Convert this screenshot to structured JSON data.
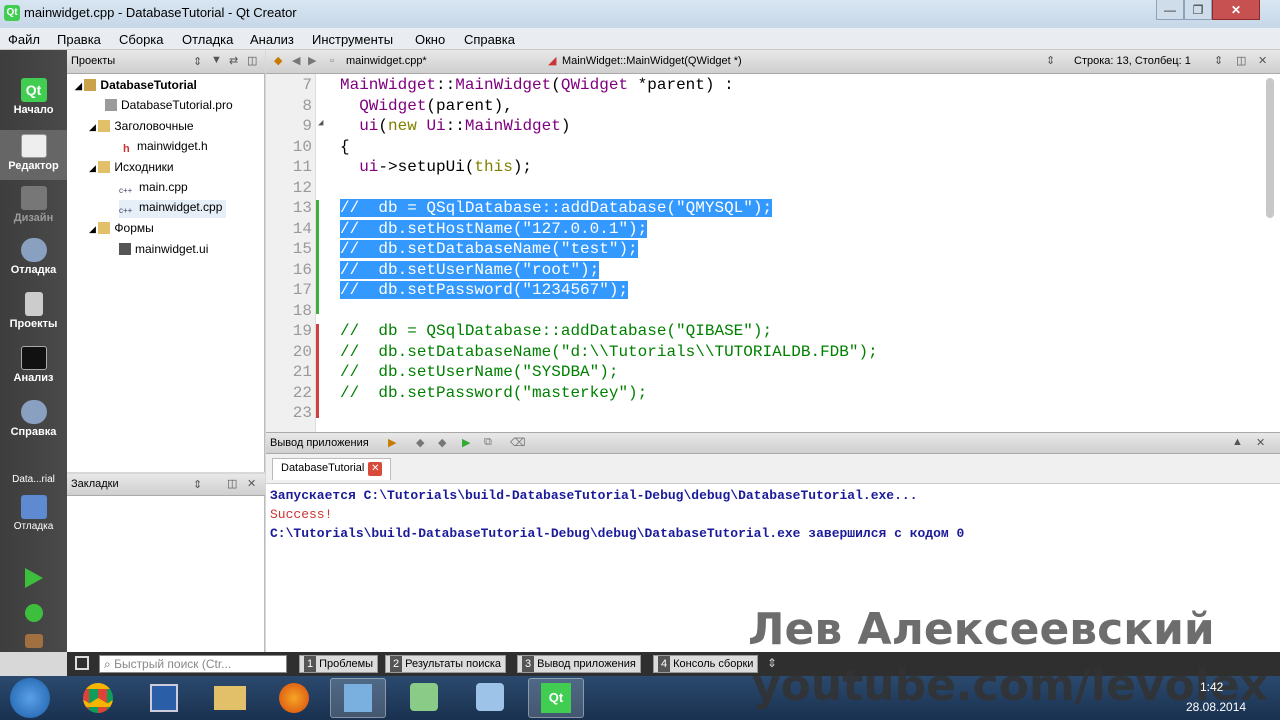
{
  "window": {
    "title": "mainwidget.cpp - DatabaseTutorial - Qt Creator",
    "app_icon_text": "Qt"
  },
  "menu": [
    "Файл",
    "Правка",
    "Сборка",
    "Отладка",
    "Анализ",
    "Инструменты",
    "Окно",
    "Справка"
  ],
  "modes": [
    {
      "label": "Начало",
      "icon": "qt-logo-icon"
    },
    {
      "label": "Редактор",
      "icon": "editor-icon"
    },
    {
      "label": "Дизайн",
      "icon": "design-icon"
    },
    {
      "label": "Отладка",
      "icon": "debug-icon"
    },
    {
      "label": "Проекты",
      "icon": "projects-icon"
    },
    {
      "label": "Анализ",
      "icon": "analyze-icon"
    },
    {
      "label": "Справка",
      "icon": "help-icon"
    }
  ],
  "target": {
    "name": "Data...rial",
    "label": "Отладка"
  },
  "projects_panel": {
    "header": "Проекты",
    "tree": [
      {
        "label": "DatabaseTutorial",
        "bold": true,
        "icon": "project-icon"
      },
      {
        "label": "DatabaseTutorial.pro",
        "icon": "pro-file-icon"
      },
      {
        "label": "Заголовочные",
        "icon": "folder-icon"
      },
      {
        "label": "mainwidget.h",
        "icon": "header-file-icon"
      },
      {
        "label": "Исходники",
        "icon": "folder-icon"
      },
      {
        "label": "main.cpp",
        "icon": "cpp-file-icon"
      },
      {
        "label": "mainwidget.cpp",
        "icon": "cpp-file-icon",
        "selected": true
      },
      {
        "label": "Формы",
        "icon": "folder-icon"
      },
      {
        "label": "mainwidget.ui",
        "icon": "ui-file-icon"
      }
    ]
  },
  "bookmarks_panel": {
    "header": "Закладки"
  },
  "editor": {
    "file_tab": "mainwidget.cpp*",
    "symbol": "MainWidget::MainWidget(QWidget *)",
    "cursor": "Строка: 13, Столбец: 1",
    "lines": [
      {
        "n": "7",
        "text": "MainWidget::MainWidget(QWidget *parent) :"
      },
      {
        "n": "8",
        "text": "  QWidget(parent),"
      },
      {
        "n": "9",
        "text": "  ui(new Ui::MainWidget)"
      },
      {
        "n": "10",
        "text": "{"
      },
      {
        "n": "11",
        "text": "  ui->setupUi(this);"
      },
      {
        "n": "12",
        "text": ""
      },
      {
        "n": "13",
        "text": "//  db = QSqlDatabase::addDatabase(\"QMYSQL\");",
        "selected": true
      },
      {
        "n": "14",
        "text": "//  db.setHostName(\"127.0.0.1\");",
        "selected": true
      },
      {
        "n": "15",
        "text": "//  db.setDatabaseName(\"test\");",
        "selected": true
      },
      {
        "n": "16",
        "text": "//  db.setUserName(\"root\");",
        "selected": true
      },
      {
        "n": "17",
        "text": "//  db.setPassword(\"1234567\");",
        "selected": true
      },
      {
        "n": "18",
        "text": ""
      },
      {
        "n": "19",
        "text": "//  db = QSqlDatabase::addDatabase(\"QIBASE\");",
        "comment": true
      },
      {
        "n": "20",
        "text": "//  db.setDatabaseName(\"d:\\\\Tutorials\\\\TUTORIALDB.FDB\");",
        "comment": true
      },
      {
        "n": "21",
        "text": "//  db.setUserName(\"SYSDBA\");",
        "comment": true
      },
      {
        "n": "22",
        "text": "//  db.setPassword(\"masterkey\");",
        "comment": true
      },
      {
        "n": "23",
        "text": ""
      }
    ]
  },
  "output": {
    "header": "Вывод приложения",
    "tab": "DatabaseTutorial",
    "lines": [
      {
        "text": "Запускается C:\\Tutorials\\build-DatabaseTutorial-Debug\\debug\\DatabaseTutorial.exe...",
        "color": "#1a1a9a"
      },
      {
        "text": "Success!",
        "color": "#cc3333"
      },
      {
        "text": "C:\\Tutorials\\build-DatabaseTutorial-Debug\\debug\\DatabaseTutorial.exe завершился с кодом 0",
        "color": "#1a1a9a"
      }
    ]
  },
  "statusbar": {
    "search_placeholder": "Быстрый поиск (Ctr...",
    "buttons": [
      {
        "num": "1",
        "label": "Проблемы"
      },
      {
        "num": "2",
        "label": "Результаты поиска"
      },
      {
        "num": "3",
        "label": "Вывод приложения"
      },
      {
        "num": "4",
        "label": "Консоль сборки"
      }
    ]
  },
  "taskbar": {
    "time": "1:42",
    "date": "28.08.2014"
  },
  "watermark": {
    "name": "Лев Алексеевский",
    "url": "youtube.com/levolex"
  }
}
